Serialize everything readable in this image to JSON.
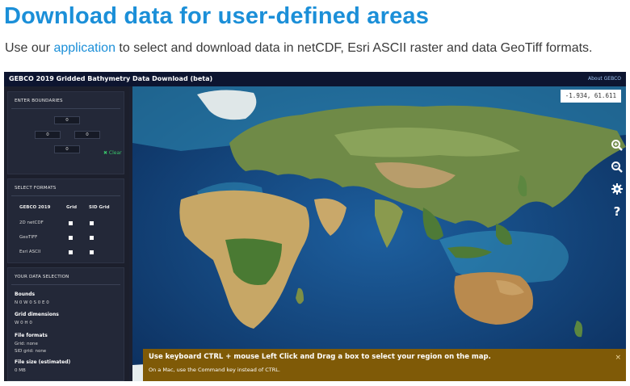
{
  "page": {
    "title": "Download data for user-defined areas",
    "intro_before": "Use our ",
    "intro_link": "application",
    "intro_after": " to select and download data in netCDF, Esri ASCII raster and data GeoTiff formats."
  },
  "app": {
    "title": "GEBCO 2019 Gridded Bathymetry Data Download (beta)",
    "about_link": "About GEBCO"
  },
  "boundaries": {
    "title": "ENTER BOUNDARIES",
    "north": "0",
    "west": "0",
    "east": "0",
    "south": "0",
    "clear_label": "✖ Clear"
  },
  "formats": {
    "title": "SELECT FORMATS",
    "header_name": "GEBCO 2019",
    "header_grid": "Grid",
    "header_sid": "SID Grid",
    "rows": [
      {
        "label": "2D netCDF",
        "grid": true,
        "sid": true
      },
      {
        "label": "GeoTIFF",
        "grid": true,
        "sid": true
      },
      {
        "label": "Esri ASCII",
        "grid": true,
        "sid": true
      }
    ]
  },
  "selection": {
    "title": "YOUR DATA SELECTION",
    "bounds_label": "Bounds",
    "bounds_value": "N 0 W 0 S 0 E 0",
    "dims_label": "Grid dimensions",
    "dims_value": "W 0 H 0",
    "formats_label": "File formats",
    "grid_value": "Grid: none",
    "sid_value": "SID grid: none",
    "size_label": "File size (estimated)",
    "size_value": "0 MB"
  },
  "map": {
    "coordinates": "-1.934,  61.611",
    "notice_main": "Use keyboard CTRL + mouse Left Click and Drag a box to select your region on the map.",
    "notice_sub": "On a Mac, use the Command key instead of CTRL.",
    "notice_close": "×",
    "controls": [
      "zoom-in-icon",
      "zoom-out-icon",
      "gear-icon",
      "help-icon"
    ]
  },
  "colors": {
    "title_blue": "#1b8fd8",
    "header_navy": "#0d1530",
    "notice_brown": "#7f5a07",
    "clear_green": "#39c46a"
  }
}
